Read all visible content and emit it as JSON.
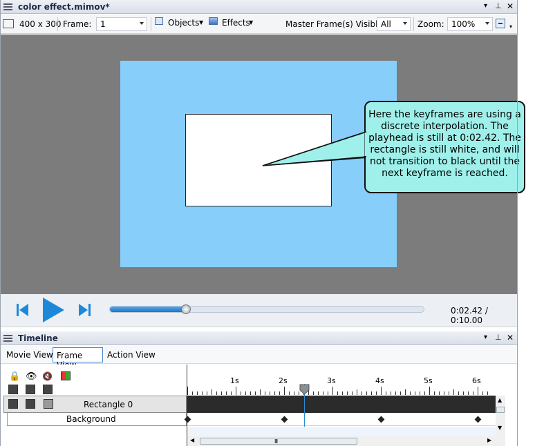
{
  "editor": {
    "title": "color effect.mimov*",
    "toolbar": {
      "size_label": "400 x 300",
      "frame_label": "Frame:",
      "frame_value": "1",
      "objects_label": "Objects",
      "effects_label": "Effects",
      "master_label": "Master Frame(s) Visible",
      "master_value": "All",
      "zoom_label": "Zoom:",
      "zoom_value": "100%"
    },
    "callout_text": "Here the keyframes are using a discrete interpolation. The playhead is still at 0:02.42. The rectangle is still white, and will not transition to black until the next keyframe is reached.",
    "colors": {
      "stage_bg": "#7c7c7c",
      "canvas": "#87cefa",
      "rect": "#ffffff",
      "callout": "#9ff0ea",
      "accent": "#1e88d8"
    },
    "playback": {
      "time": "0:02.42 / 0:10.00",
      "progress": 0.242
    }
  },
  "timeline": {
    "title": "Timeline",
    "tabs": [
      "Movie View",
      "Frame View",
      "Action View"
    ],
    "active_tab": "Frame View",
    "ruler": [
      "1s",
      "2s",
      "3s",
      "4s",
      "5s",
      "6s"
    ],
    "tracks": [
      {
        "name": "Rectangle 0"
      },
      {
        "name": "Background",
        "keyframes_seconds": [
          0,
          2,
          4,
          6
        ]
      }
    ],
    "playhead_seconds": 2.42
  }
}
